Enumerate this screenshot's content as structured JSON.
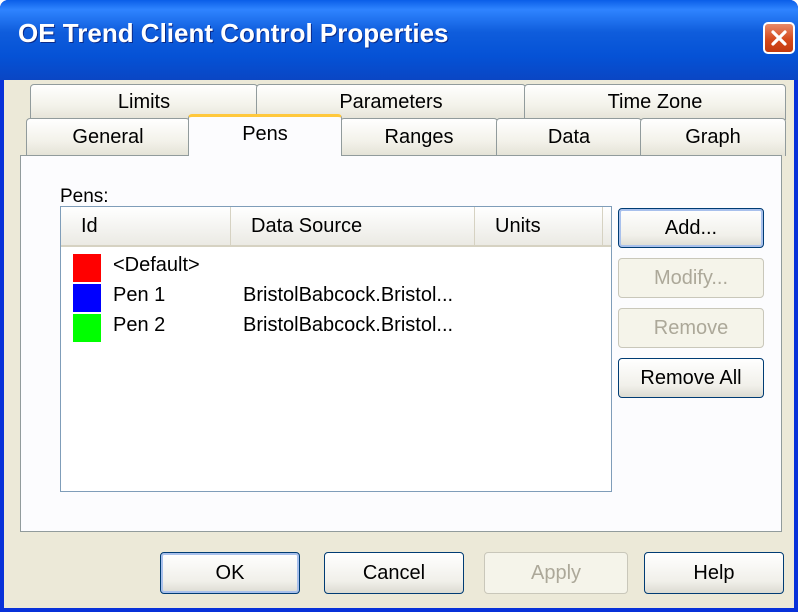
{
  "window": {
    "title": "OE Trend Client Control Properties",
    "close_icon": "close-x-icon"
  },
  "tabs": {
    "limits": "Limits",
    "parameters": "Parameters",
    "time_zone": "Time Zone",
    "general": "General",
    "pens": "Pens",
    "ranges": "Ranges",
    "data": "Data",
    "graph": "Graph",
    "active": "Pens"
  },
  "pens_panel": {
    "label": "Pens:",
    "columns": {
      "id": "Id",
      "data_source": "Data Source",
      "units": "Units"
    },
    "rows": [
      {
        "id": "<Default>",
        "data_source": "",
        "units": "",
        "color": "#ff0000"
      },
      {
        "id": "Pen 1",
        "data_source": "BristolBabcock.Bristol...",
        "units": "",
        "color": "#0000ff"
      },
      {
        "id": "Pen 2",
        "data_source": "BristolBabcock.Bristol...",
        "units": "",
        "color": "#00ff00"
      }
    ],
    "buttons": {
      "add": "Add...",
      "modify": "Modify...",
      "remove": "Remove",
      "remove_all": "Remove All"
    }
  },
  "footer": {
    "ok": "OK",
    "cancel": "Cancel",
    "apply": "Apply",
    "help": "Help"
  },
  "colors": {
    "titlebar": "#0552d6",
    "dialog_bg": "#ece9d8",
    "active_tab_highlight": "#ffc83c"
  }
}
